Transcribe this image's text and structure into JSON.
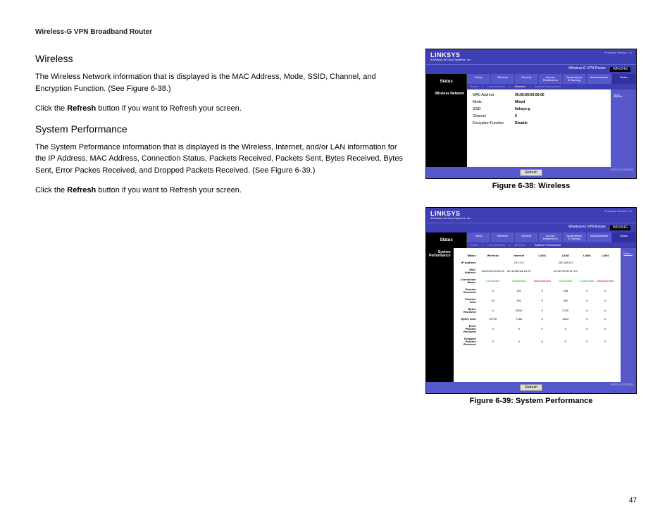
{
  "header": "Wireless-G VPN Broadband Router",
  "page_number": "47",
  "sections": {
    "wireless": {
      "heading": "Wireless",
      "p1a": "The Wireless Network information that is displayed is the MAC Address, Mode, SSID, Channel, and Encryption Function. (See Figure 6-38.)",
      "p2a": "Click the ",
      "p2b": "Refresh",
      "p2c": " button if you want to Refresh your screen."
    },
    "sysperf": {
      "heading": "System Performance",
      "p1": "The System Peformance information that is displayed is the Wireless, Internet, and/or LAN information for the IP Address, MAC Address, Connection Status, Packets Received, Packets Sent, Bytes Received, Bytes Sent, Error Packes Received, and Dropped Packets Received. (See Figure 6-39.)",
      "p2a": "Click the ",
      "p2b": "Refresh",
      "p2c": " button if you want to Refresh your screen."
    }
  },
  "figure38_caption": "Figure 6-38: Wireless",
  "figure39_caption": "Figure 6-39: System Performance",
  "router": {
    "brand": "LINKSYS",
    "subbrand": "A Division of Cisco Systems, Inc.",
    "firmware": "Firmware Version: 1.0",
    "product": "Wireless-G VPN Router",
    "model": "WRV54G",
    "side_status": "Status",
    "tabs": [
      "Setup",
      "Wireless",
      "Security",
      "Access Restrictions",
      "Applications & Gaming",
      "Administration",
      "Status"
    ],
    "subtabs38": [
      "Router",
      "Local Network",
      "Wireless",
      "System Performance"
    ],
    "subtabs39": [
      "Router",
      "Local Network",
      "Wireless",
      "System Performance"
    ],
    "more": "More...",
    "refresh_btn": "Refresh",
    "cisco": "CISCO SYSTEMS"
  },
  "fig38": {
    "side_label": "Wireless Network",
    "rows": {
      "mac_k": "MAC Address",
      "mac_v": "00:00:00:00:00:00",
      "mode_k": "Mode:",
      "mode_v": "Mixed",
      "ssid_k": "SSID",
      "ssid_v": "linksys-g",
      "channel_k": "Channel",
      "channel_v": "6",
      "enc_k": "Encryption Function",
      "enc_v": "Disable"
    }
  },
  "fig39": {
    "side_label": "System Performance",
    "headers": [
      "Wireless",
      "Internet",
      "LAN1",
      "LAN2",
      "LAN3",
      "LAN4"
    ],
    "row_labels": {
      "status": "Status",
      "ip": "IP Address",
      "mac": "MAC Address",
      "conn": "Connection Status",
      "pktr": "Packets Received",
      "pkts": "Packets Sent",
      "byr": "Bytes Received",
      "bys": "Bytes Sent",
      "err": "Error Packets Received",
      "drp": "Dropped Packets Received"
    },
    "ip": [
      "",
      "20.0.0.2",
      "",
      "192.168.0.2",
      "",
      ""
    ],
    "mac": [
      "00:00:00:00:00:00",
      "0C:10:B5:0A:13:75",
      "",
      "20:30:7D:30:1F:C0",
      "",
      ""
    ],
    "conn": [
      "Connected",
      "Connected",
      "Disconnected",
      "Connected",
      "Connected",
      "Disconnected"
    ],
    "conn_cls": [
      "green",
      "green",
      "red",
      "green",
      "green",
      "red"
    ],
    "pktr": [
      "0",
      "102",
      "0",
      "168",
      "0",
      "0"
    ],
    "pkts": [
      "20",
      "102",
      "0",
      "262",
      "0",
      "0"
    ],
    "byr": [
      "0",
      "6004",
      "0",
      "2740",
      "0",
      "0"
    ],
    "bys": [
      "10730",
      "7184",
      "0",
      "3243",
      "0",
      "0"
    ],
    "err": [
      "0",
      "0",
      "0",
      "0",
      "0",
      "0"
    ],
    "drp": [
      "0",
      "0",
      "0",
      "0",
      "0",
      "0"
    ]
  }
}
